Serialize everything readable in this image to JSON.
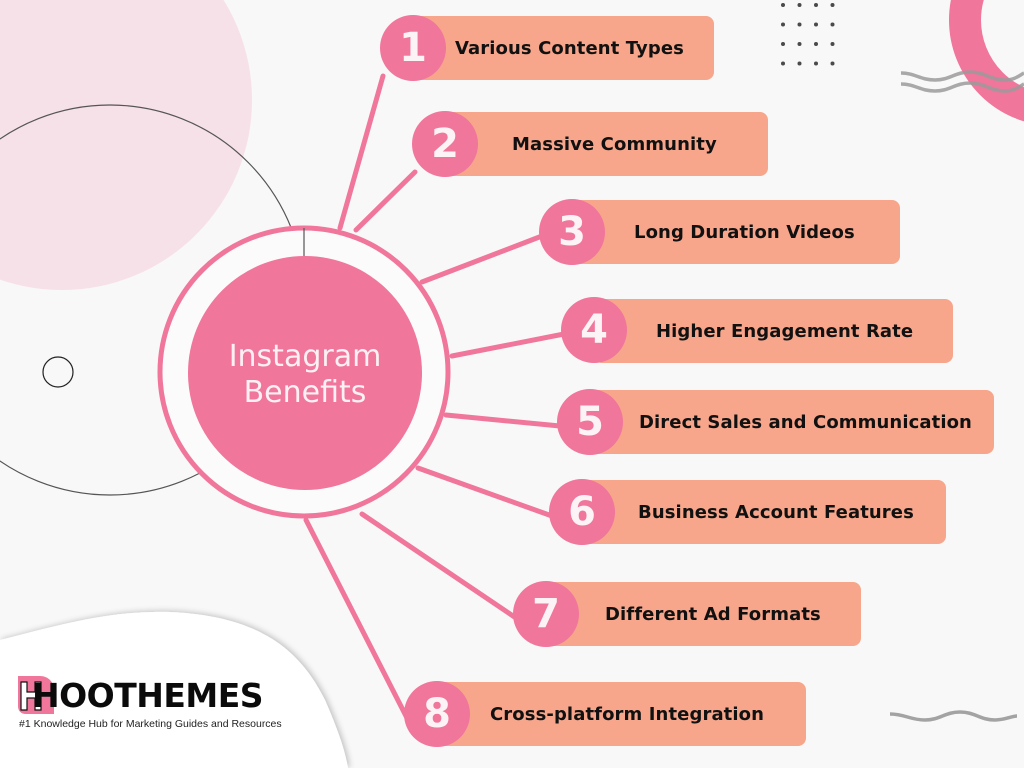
{
  "title": {
    "line1": "Instagram",
    "line2": "Benefits"
  },
  "items": [
    {
      "number": "1",
      "label": "Various Content Types"
    },
    {
      "number": "2",
      "label": "Massive Community"
    },
    {
      "number": "3",
      "label": "Long Duration Videos"
    },
    {
      "number": "4",
      "label": "Higher Engagement Rate"
    },
    {
      "number": "5",
      "label": "Direct Sales and Communication"
    },
    {
      "number": "6",
      "label": "Business Account Features"
    },
    {
      "number": "7",
      "label": "Different Ad Formats"
    },
    {
      "number": "8",
      "label": "Cross-platform Integration"
    }
  ],
  "brand": {
    "name": "HOOTHEMES",
    "tagline": "#1 Knowledge Hub for Marketing Guides and Resources"
  },
  "colors": {
    "accent_pink": "#f0769b",
    "pill_salmon": "#f7a68b",
    "soft_pink": "#f6e1e8",
    "background": "#f8f8f8"
  }
}
